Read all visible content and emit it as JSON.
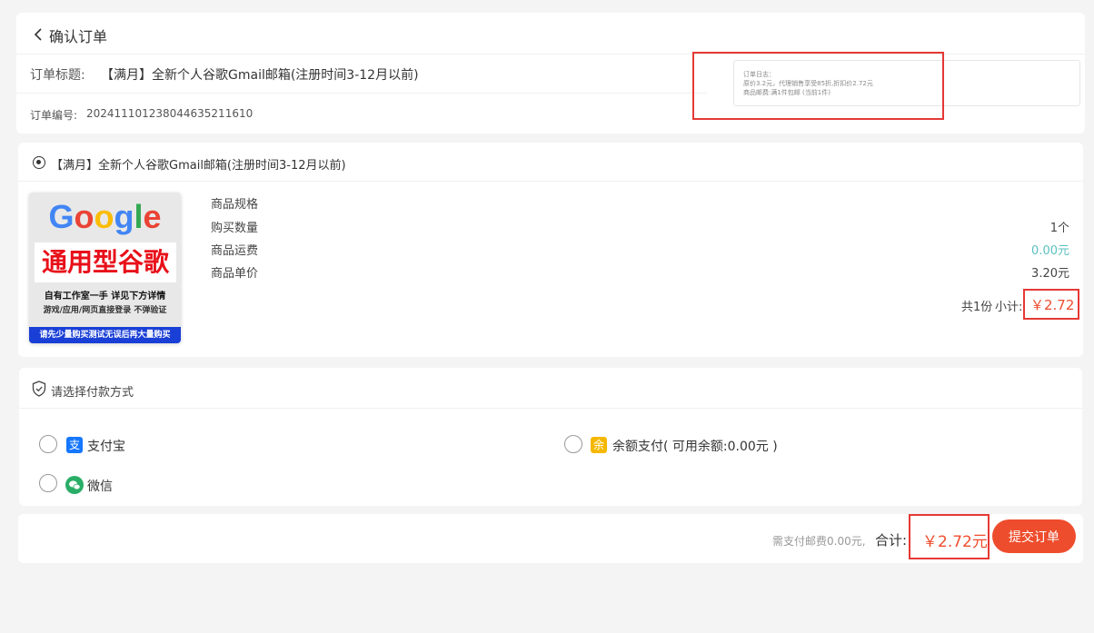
{
  "header": {
    "title": "确认订单",
    "order_title_label": "订单标题:",
    "order_title": "【满月】全新个人谷歌Gmail邮箱(注册时间3-12月以前)",
    "order_no_label": "订单编号:",
    "order_no": "202411101238044635211610",
    "log_title": "订单日志：",
    "log_line1": "原价3.2元，代理销售享受85折,折扣价2.72元",
    "log_line2": "商品邮费:满1件包邮 (当前1件)"
  },
  "product": {
    "name": "【满月】全新个人谷歌Gmail邮箱(注册时间3-12月以前)",
    "image": {
      "logo": [
        "G",
        "o",
        "o",
        "g",
        "l",
        "e"
      ],
      "banner": "通用型谷歌",
      "line1": "自有工作室一手  详见下方详情",
      "line2": "游戏/应用/网页直接登录 不弹验证",
      "footer": "请先少量购买测试无误后再大量购买"
    },
    "spec_label": "商品规格",
    "qty_label": "购买数量",
    "qty_value": "1个",
    "shipping_label": "商品运费",
    "shipping_value": "0.00元",
    "price_label": "商品单价",
    "price_value": "3.20元",
    "count_text": "共1份",
    "subtotal_label": "小计:",
    "subtotal_value": "￥2.72"
  },
  "payment": {
    "title": "请选择付款方式",
    "alipay_label": "支付宝",
    "alipay_icon_char": "支",
    "balance_label": "余额支付( 可用余额:0.00元 )",
    "balance_icon_char": "余",
    "wechat_label": "微信"
  },
  "footer": {
    "shipping_note": "需支付邮费0.00元,",
    "total_label": "合计:",
    "total_value": "￥2.72元",
    "submit_label": "提交订单"
  },
  "colors": {
    "accent": "#ee4d2d",
    "shipping_green": "#5bc0be",
    "alipay_blue": "#1677ff",
    "balance_yellow": "#f5b800",
    "wechat_green": "#2aae67",
    "highlight_red": "#e53935"
  }
}
